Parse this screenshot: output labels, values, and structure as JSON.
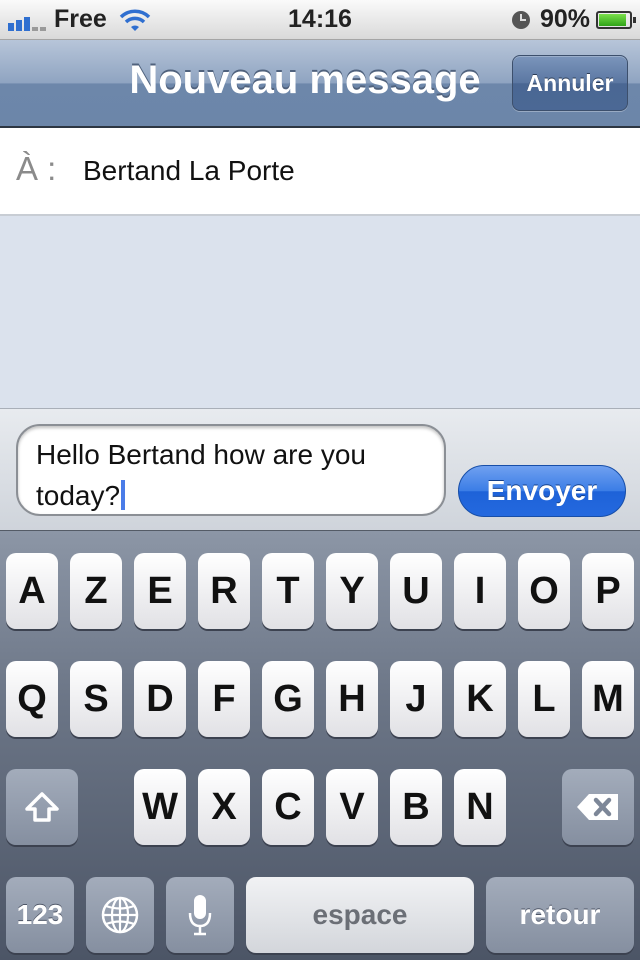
{
  "status_bar": {
    "carrier": "Free",
    "time": "14:16",
    "battery_percent": "90%",
    "battery_level": 0.9,
    "signal_icon": "signal-bars-icon",
    "wifi_icon": "wifi-icon",
    "clock_icon": "alarm-clock-icon"
  },
  "nav": {
    "title": "Nouveau message",
    "cancel_label": "Annuler"
  },
  "recipient": {
    "label": "À :",
    "value": "Bertand La Porte"
  },
  "compose": {
    "message_text": "Hello Bertand how are you today?",
    "send_label": "Envoyer"
  },
  "keyboard": {
    "row1": [
      "A",
      "Z",
      "E",
      "R",
      "T",
      "Y",
      "U",
      "I",
      "O",
      "P"
    ],
    "row2": [
      "Q",
      "S",
      "D",
      "F",
      "G",
      "H",
      "J",
      "K",
      "L",
      "M"
    ],
    "row3": [
      "W",
      "X",
      "C",
      "V",
      "B",
      "N"
    ],
    "numbers_label": "123",
    "space_label": "espace",
    "return_label": "retour",
    "shift_icon": "shift-arrow-icon",
    "delete_icon": "backspace-icon",
    "globe_icon": "globe-icon",
    "mic_icon": "microphone-icon"
  },
  "colors": {
    "accent_blue": "#2469df",
    "nav_bar": "#6c86a9",
    "background": "#dbe2ed"
  }
}
